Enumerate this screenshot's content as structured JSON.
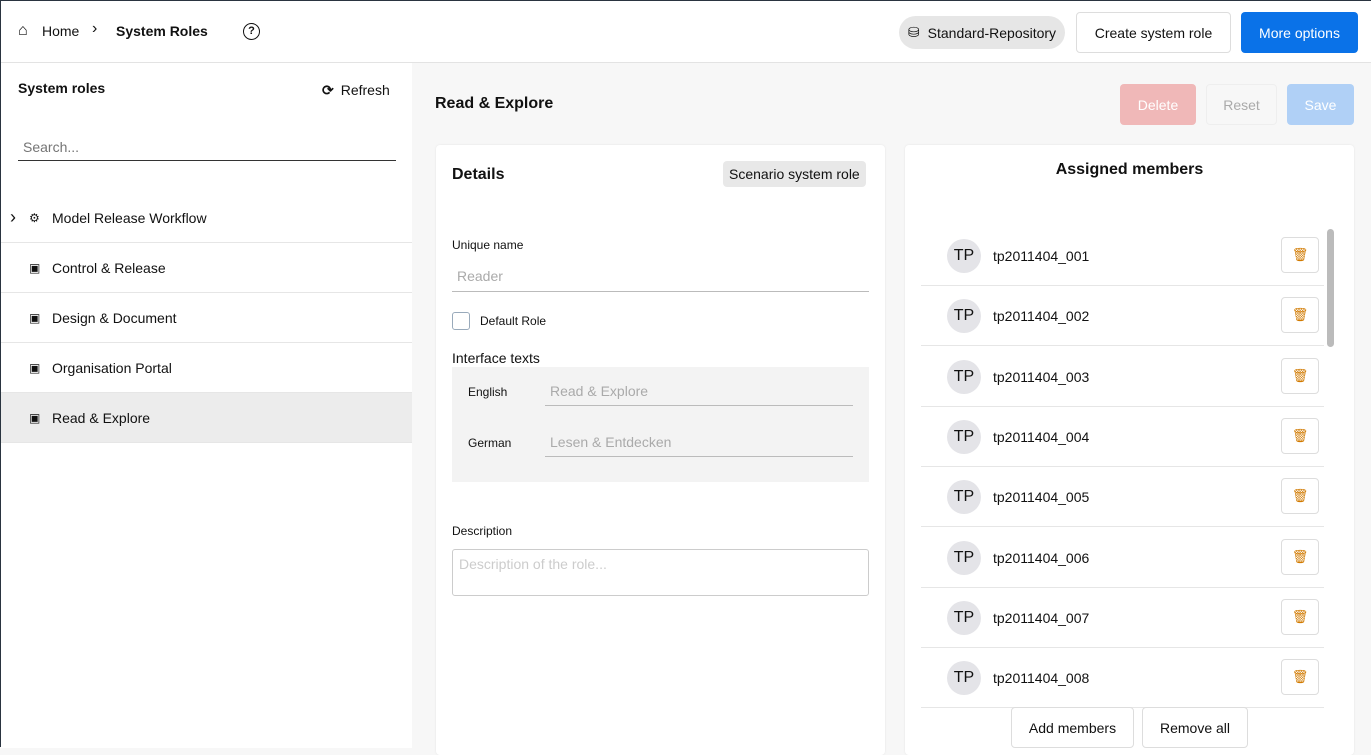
{
  "header": {
    "home": "Home",
    "current": "System Roles",
    "repository": "Standard-Repository",
    "create": "Create system role",
    "more": "More options"
  },
  "sidebar": {
    "title": "System roles",
    "refresh": "Refresh",
    "search_placeholder": "Search...",
    "items": [
      {
        "label": "Model Release Workflow"
      },
      {
        "label": "Control & Release"
      },
      {
        "label": "Design & Document"
      },
      {
        "label": "Organisation Portal"
      },
      {
        "label": "Read & Explore"
      }
    ]
  },
  "main": {
    "title": "Read & Explore",
    "delete": "Delete",
    "reset": "Reset",
    "save": "Save"
  },
  "details": {
    "title": "Details",
    "badge": "Scenario system role",
    "unique_name_label": "Unique name",
    "unique_name_placeholder": "Reader",
    "default_role": "Default Role",
    "interface_texts": "Interface texts",
    "english_label": "English",
    "english_placeholder": "Read & Explore",
    "german_label": "German",
    "german_placeholder": "Lesen & Entdecken",
    "description_label": "Description",
    "description_placeholder": "Description of the role..."
  },
  "members": {
    "title": "Assigned members",
    "add": "Add members",
    "remove_all": "Remove all",
    "list": [
      {
        "initials": "TP",
        "name": "tp2011404_001"
      },
      {
        "initials": "TP",
        "name": "tp2011404_002"
      },
      {
        "initials": "TP",
        "name": "tp2011404_003"
      },
      {
        "initials": "TP",
        "name": "tp2011404_004"
      },
      {
        "initials": "TP",
        "name": "tp2011404_005"
      },
      {
        "initials": "TP",
        "name": "tp2011404_006"
      },
      {
        "initials": "TP",
        "name": "tp2011404_007"
      },
      {
        "initials": "TP",
        "name": "tp2011404_008"
      }
    ]
  }
}
